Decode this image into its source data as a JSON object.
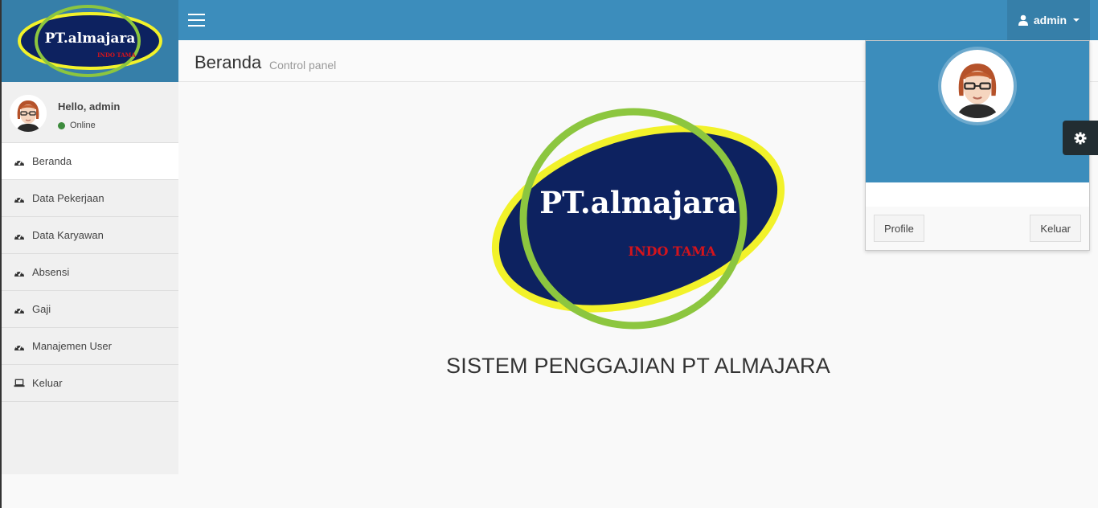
{
  "brand": {
    "logo_text": "PT.almajara",
    "logo_subtext": "INDO TAMA"
  },
  "topbar": {
    "user_name": "admin"
  },
  "sidebar": {
    "user": {
      "greeting": "Hello, admin",
      "status": "Online"
    },
    "items": [
      {
        "label": "Beranda",
        "icon": "dashboard-icon"
      },
      {
        "label": "Data Pekerjaan",
        "icon": "dashboard-icon"
      },
      {
        "label": "Data Karyawan",
        "icon": "dashboard-icon"
      },
      {
        "label": "Absensi",
        "icon": "dashboard-icon"
      },
      {
        "label": "Gaji",
        "icon": "dashboard-icon"
      },
      {
        "label": "Manajemen User",
        "icon": "dashboard-icon"
      },
      {
        "label": "Keluar",
        "icon": "laptop-icon"
      }
    ]
  },
  "content": {
    "title": "Beranda",
    "subtitle": "Control panel",
    "system_title": "SISTEM PENGGAJIAN PT ALMAJARA"
  },
  "dropdown": {
    "profile_label": "Profile",
    "logout_label": "Keluar"
  },
  "colors": {
    "topbar": "#3c8dbc",
    "logo_bg": "#367fa9",
    "logo_navy": "#0d2260",
    "ring_yellow": "#f2f22a",
    "ring_green": "#8cc63f",
    "logo_red": "#d4141c"
  }
}
